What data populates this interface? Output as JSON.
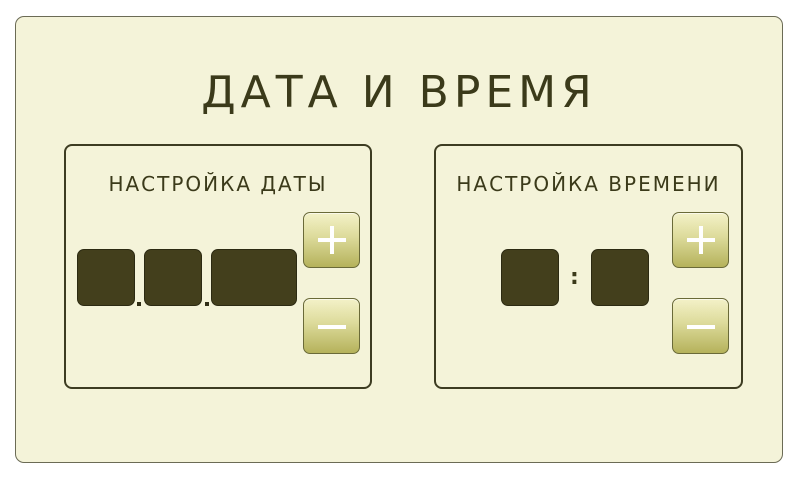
{
  "page": {
    "title": "ДАТА И ВРЕМЯ"
  },
  "date_settings": {
    "title": "НАСТРОЙКА ДАТЫ",
    "day": "",
    "month": "",
    "year": "",
    "increment_icon": "plus-icon",
    "decrement_icon": "minus-icon"
  },
  "time_settings": {
    "title": "НАСТРОЙКА ВРЕМЕНИ",
    "hours": "",
    "minutes": "",
    "separator": ":",
    "increment_icon": "plus-icon",
    "decrement_icon": "minus-icon"
  },
  "colors": {
    "background": "#f4f3d9",
    "field": "#433f1c",
    "button_top": "#f4f2c8",
    "button_bottom": "#b5b25b",
    "text": "#3b3a1a"
  }
}
